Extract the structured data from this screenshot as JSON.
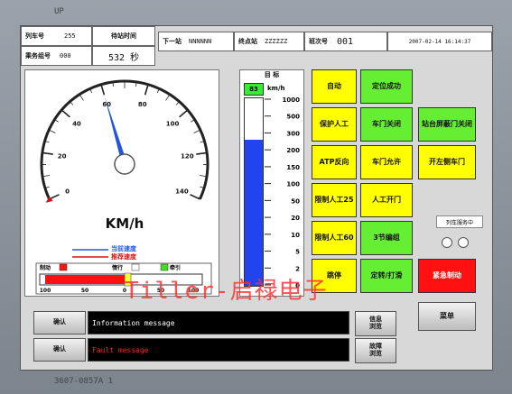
{
  "bezel": {
    "top_label": "UP",
    "bottom_label": "3607-0857A   1"
  },
  "header": {
    "train_no_label": "列车号",
    "train_no_value": "255",
    "time_label": "待站时间",
    "next_station_label": "下一站",
    "next_station_value": "NNNNNN",
    "terminal_label": "终点站",
    "terminal_value": "ZZZZZZ",
    "route_label": "班次号",
    "route_value": "001",
    "datetime": "2007-02-14 16:14:37",
    "service_label": "乘务组号",
    "service_value": "000",
    "wait_value": "532 秒"
  },
  "speedometer": {
    "unit": "KM/h",
    "ticks": [
      "0",
      "20",
      "40",
      "60",
      "80",
      "100",
      "120",
      "140"
    ],
    "current_speed": 60,
    "max_speed": 140,
    "legend_current": "当前速度",
    "legend_recommended": "推荐速度"
  },
  "mode_bar": {
    "labels": [
      "制动",
      "惰行",
      "牵引"
    ],
    "scale": [
      "100",
      "50",
      "0",
      "50",
      "100"
    ],
    "brake_fraction": 0.6
  },
  "target_bar": {
    "header": "目  标",
    "value": "83",
    "unit": "km/h",
    "ticks": [
      "1000",
      "500",
      "300",
      "200",
      "150",
      "100",
      "50",
      "20",
      "10",
      "5",
      "2",
      "0"
    ],
    "fill_fraction": 0.78
  },
  "buttons": {
    "auto": "自动",
    "position_ok": "定位成功",
    "protect_manual": "保护人工",
    "door_closed": "车门关闭",
    "platform_screen_closed": "站台屏蔽门关闭",
    "atp_reverse": "ATP反向",
    "door_allowed": "车门允许",
    "open_left_door": "开左侧车门",
    "restricted_manual_25": "限制人工25",
    "manual_door_open": "人工开门",
    "restricted_manual_60": "限制人工60",
    "three_section": "3节编组",
    "skip_stop": "跳停",
    "hold_release": "定转/打滑",
    "emergency_brake": "紧急制动",
    "train_status": "列车服务中",
    "menu": "菜单"
  },
  "messages": {
    "confirm1": "确认",
    "confirm2": "确认",
    "info": "Information message",
    "fault": "Fault message",
    "info_page": "信息\n浏览",
    "fault_page": "故障\n浏览"
  },
  "colors": {
    "info_text": "#ffffff",
    "fault_text": "#ff2020",
    "needle": "#2255dd",
    "bar_fill": "#2244ee"
  },
  "watermark": "Tiller-启禄电子"
}
